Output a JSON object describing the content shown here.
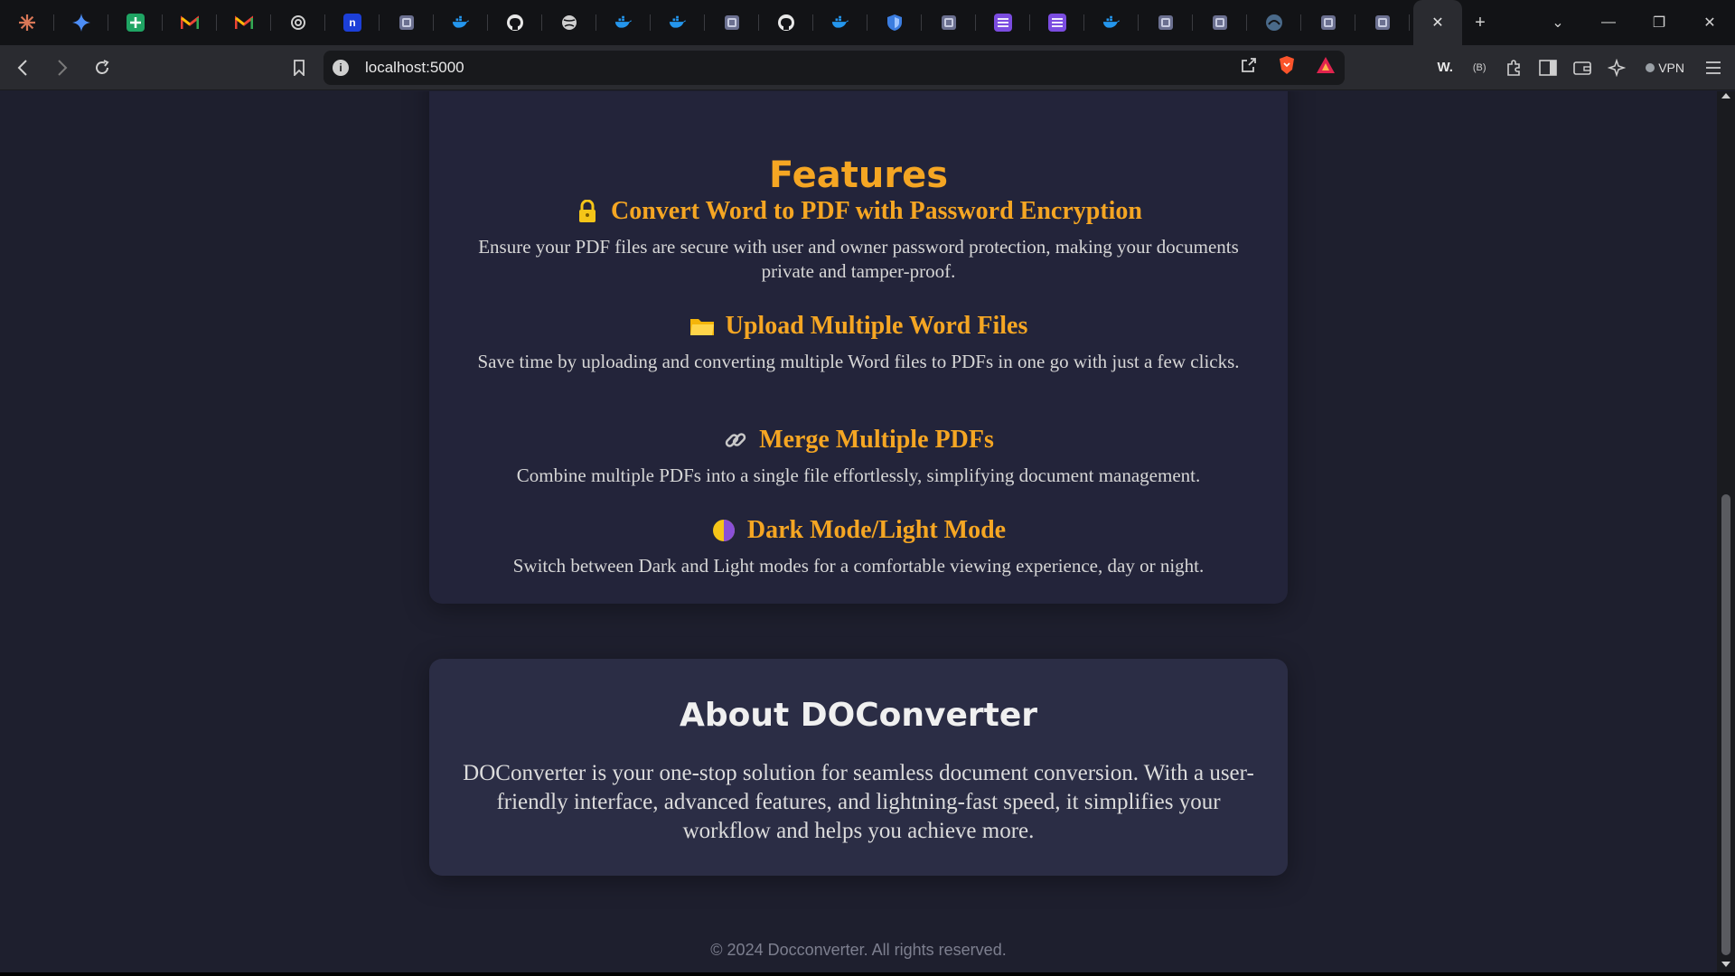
{
  "browser": {
    "url": "localhost:5000",
    "vpn_label": "VPN",
    "tabs": [
      {
        "icon": "claude-icon",
        "color": "#d97757"
      },
      {
        "icon": "gemini-icon",
        "color": "#4c8df6"
      },
      {
        "icon": "google-sheets-icon",
        "color": "#1fa463"
      },
      {
        "icon": "gmail-icon",
        "color": "#ea4335"
      },
      {
        "icon": "gmail-icon",
        "color": "#ea4335"
      },
      {
        "icon": "openai-icon",
        "color": "#cfcfcf"
      },
      {
        "icon": "n-app-icon",
        "color": "#1c3fd8",
        "letter": "n"
      },
      {
        "icon": "app-icon",
        "color": "#6b7090"
      },
      {
        "icon": "docker-icon",
        "color": "#2496ed"
      },
      {
        "icon": "github-icon",
        "color": "#e8e8e8"
      },
      {
        "icon": "globe-icon",
        "color": "#cfcfcf"
      },
      {
        "icon": "docker-icon",
        "color": "#2496ed"
      },
      {
        "icon": "docker-icon",
        "color": "#2496ed"
      },
      {
        "icon": "app-icon",
        "color": "#6b7090"
      },
      {
        "icon": "github-icon",
        "color": "#e8e8e8"
      },
      {
        "icon": "docker-icon",
        "color": "#2496ed"
      },
      {
        "icon": "shield-icon",
        "color": "#3b7de0"
      },
      {
        "icon": "app-icon",
        "color": "#6b7090"
      },
      {
        "icon": "list-icon",
        "color": "#7b4ce0"
      },
      {
        "icon": "list-icon",
        "color": "#7b4ce0"
      },
      {
        "icon": "docker-icon",
        "color": "#2496ed"
      },
      {
        "icon": "app-icon",
        "color": "#6b7090"
      },
      {
        "icon": "app-icon",
        "color": "#6b7090"
      },
      {
        "icon": "edge-icon",
        "color": "#4a6a8a"
      },
      {
        "icon": "app-icon",
        "color": "#6b7090"
      },
      {
        "icon": "app-icon",
        "color": "#6b7090"
      }
    ]
  },
  "features": {
    "title": "Features",
    "items": [
      {
        "icon": "lock-icon",
        "title": "Convert Word to PDF with Password Encryption",
        "desc": "Ensure your PDF files are secure with user and owner password protection, making your documents private and tamper-proof."
      },
      {
        "icon": "folder-icon",
        "title": "Upload Multiple Word Files",
        "desc": "Save time by uploading and converting multiple Word files to PDFs in one go with just a few clicks."
      },
      {
        "icon": "link-icon",
        "title": "Merge Multiple PDFs",
        "desc": "Combine multiple PDFs into a single file effortlessly, simplifying document management."
      },
      {
        "icon": "half-moon-icon",
        "title": "Dark Mode/Light Mode",
        "desc": "Switch between Dark and Light modes for a comfortable viewing experience, day or night."
      }
    ]
  },
  "about": {
    "title": "About DOConverter",
    "text": "DOConverter is your one-stop solution for seamless document conversion. With a user-friendly interface, advanced features, and lightning-fast speed, it simplifies your workflow and helps you achieve more."
  },
  "footer": {
    "text": "© 2024 Docconverter. All rights reserved."
  },
  "colors": {
    "accent": "#f5a623",
    "background": "#1e1f2e",
    "card": "#23243a",
    "about_card": "#2b2d45"
  }
}
